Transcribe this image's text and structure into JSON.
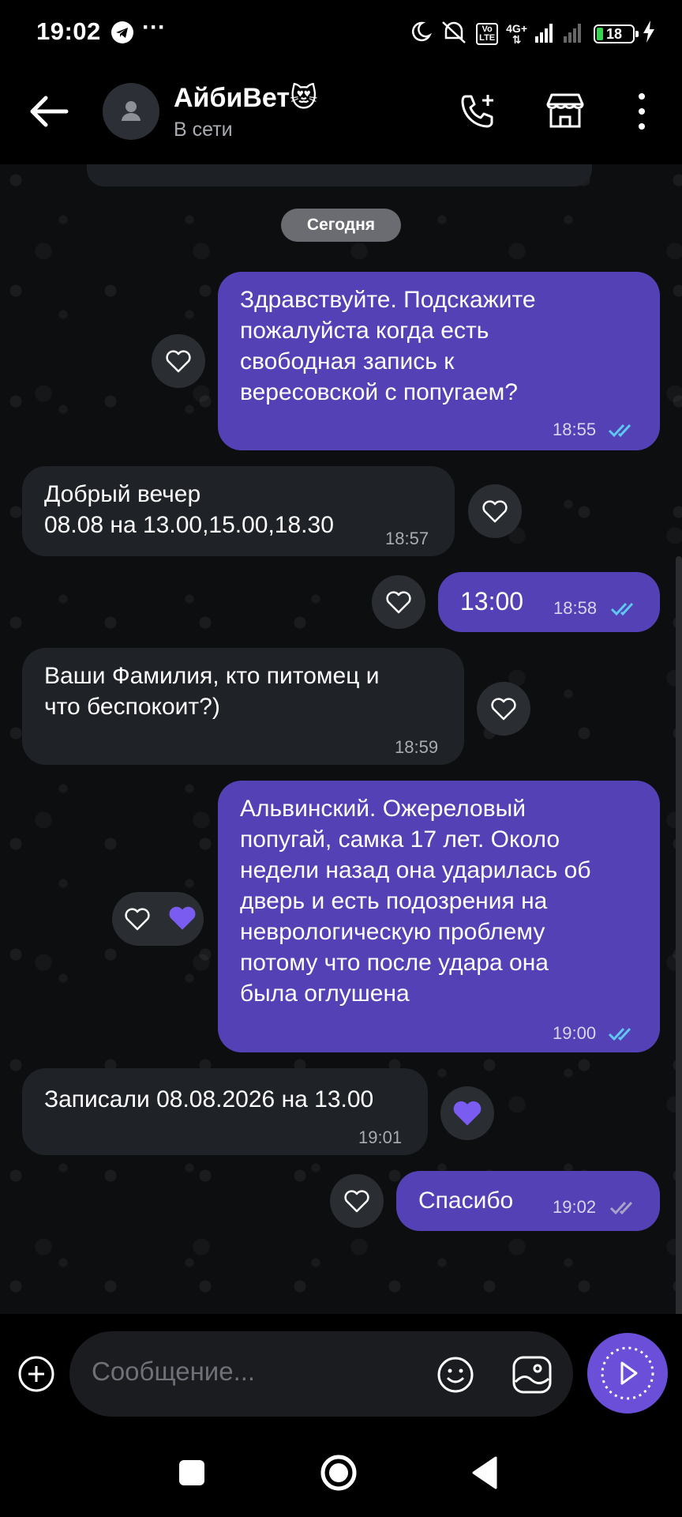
{
  "status_bar": {
    "time": "19:02",
    "more": "···",
    "battery": "18",
    "net_top": "4G+",
    "volte_top": "Vo",
    "volte_bottom": "LTE"
  },
  "header": {
    "title": "АйбиВет😻",
    "status": "В сети"
  },
  "date_divider": "Сегодня",
  "messages": [
    {
      "text": "Здравствуйте. Подскажите\nпожалуйста когда есть\nсвободная запись к\nвересовской с попугаем?",
      "time": "18:55"
    },
    {
      "text": "Добрый вечер\n08.08 на 13.00,15.00,18.30",
      "time": "18:57"
    },
    {
      "text": "13:00",
      "time": "18:58"
    },
    {
      "text": "Ваши Фамилия, кто питомец и\nчто беспокоит?)",
      "time": "18:59"
    },
    {
      "text": "Альвинский. Ожереловый\nпопугай, самка 17 лет. Около\nнедели назад она ударилась об\nдверь и есть подозрения на\nневрологическую проблему\nпотому что после удара она\nбыла оглушена",
      "time": "19:00"
    },
    {
      "text": "Записали 08.08.2026 на 13.00",
      "time": "19:01"
    },
    {
      "text": "Спасибо",
      "time": "19:02"
    }
  ],
  "composer": {
    "placeholder": "Сообщение..."
  },
  "colors": {
    "outgoing": "#5341b5",
    "incoming": "#1f2227",
    "accent": "#6b4fd8",
    "read_ticks": "#5ec8f2"
  }
}
